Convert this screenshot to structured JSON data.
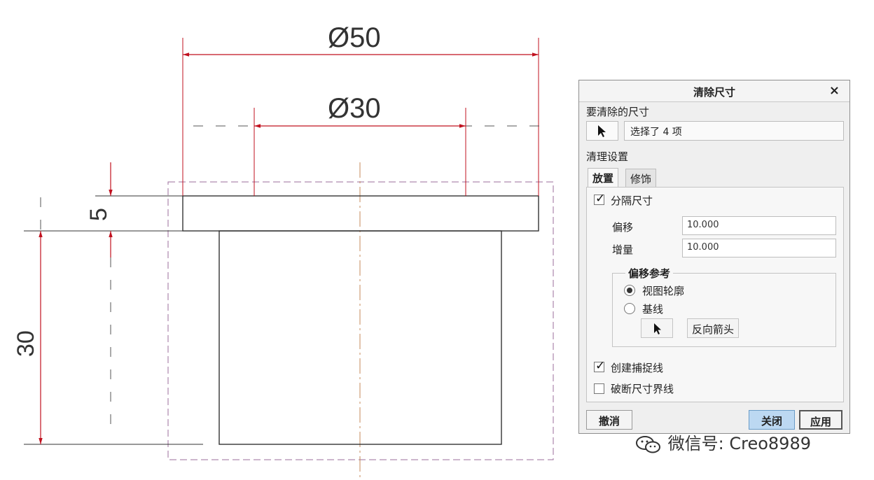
{
  "drawing": {
    "dimensions": {
      "top_diameter": "Ø50",
      "inner_diameter": "Ø30",
      "flange_height": "5",
      "body_height": "30"
    },
    "colors": {
      "dimension": "#c0111f",
      "geometry": "#333333",
      "centerline": "#c58a5a",
      "dashed_box": "#9b6c9b"
    }
  },
  "dialog": {
    "title": "清除尺寸",
    "close_icon": "close-icon",
    "dims_to_clean_label": "要清除的尺寸",
    "selection_text": "选择了 4 项",
    "settings_label": "清理设置",
    "tabs": [
      {
        "label": "放置",
        "active": true
      },
      {
        "label": "修饰",
        "active": false
      }
    ],
    "placement": {
      "separate_dims_label": "分隔尺寸",
      "separate_dims_checked": true,
      "offset_label": "偏移",
      "offset_value": "10.000",
      "increment_label": "增量",
      "increment_value": "10.000",
      "offset_ref_title": "偏移参考",
      "ref_options": [
        {
          "label": "视图轮廓",
          "selected": true
        },
        {
          "label": "基线",
          "selected": false
        }
      ],
      "flip_arrow_label": "反向箭头",
      "create_snap_lines_label": "创建捕捉线",
      "create_snap_lines_checked": true,
      "break_witness_label": "破断尺寸界线",
      "break_witness_checked": false
    },
    "buttons": {
      "cancel": "撤消",
      "close": "关闭",
      "apply": "应用"
    },
    "close_button_color": "#bcd8f2"
  },
  "watermark": {
    "text": "微信号: Creo8989",
    "icon": "wechat-icon"
  }
}
